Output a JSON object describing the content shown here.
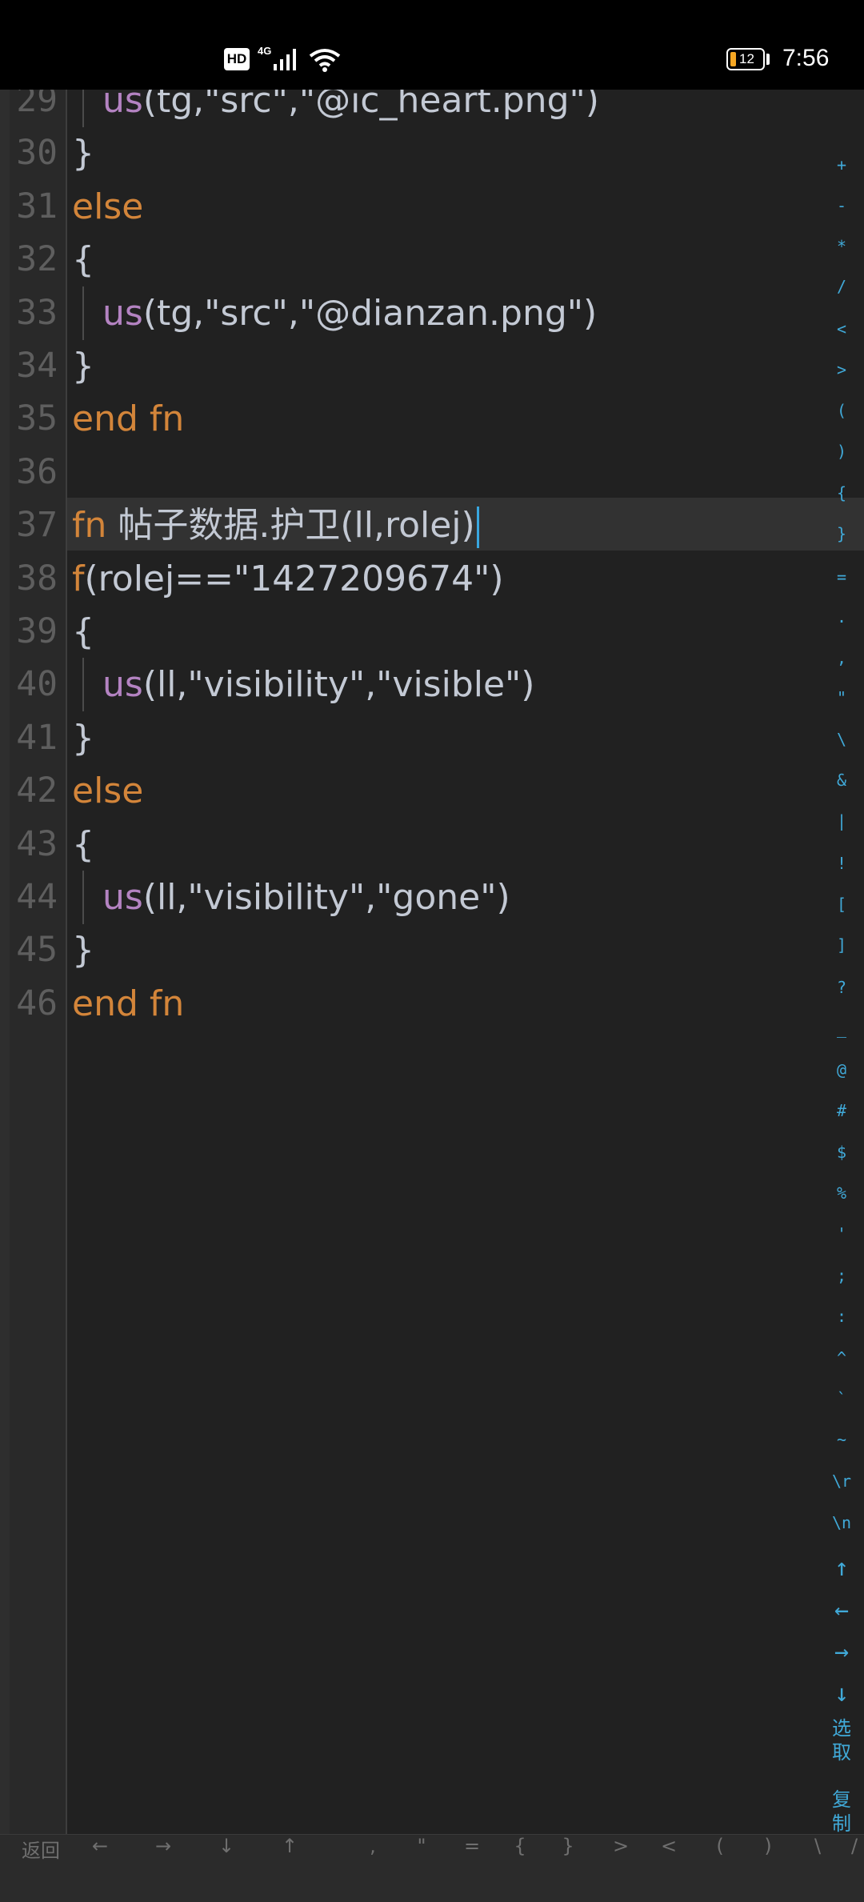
{
  "status_bar": {
    "hd": "HD",
    "network": "4G",
    "battery": "12",
    "time": "7:56"
  },
  "editor": {
    "lines": [
      {
        "n": "29",
        "indent": true,
        "tokens": [
          {
            "t": "us",
            "c": "fnc"
          },
          {
            "t": "(tg,\"src\",\"@ic_heart.png\")",
            "c": ""
          }
        ]
      },
      {
        "n": "30",
        "indent": false,
        "tokens": [
          {
            "t": "}",
            "c": ""
          }
        ]
      },
      {
        "n": "31",
        "indent": false,
        "tokens": [
          {
            "t": "else",
            "c": "kw"
          }
        ]
      },
      {
        "n": "32",
        "indent": false,
        "tokens": [
          {
            "t": "{",
            "c": ""
          }
        ]
      },
      {
        "n": "33",
        "indent": true,
        "tokens": [
          {
            "t": "us",
            "c": "fnc"
          },
          {
            "t": "(tg,\"src\",\"@dianzan.png\")",
            "c": ""
          }
        ]
      },
      {
        "n": "34",
        "indent": false,
        "tokens": [
          {
            "t": "}",
            "c": ""
          }
        ]
      },
      {
        "n": "35",
        "indent": false,
        "tokens": [
          {
            "t": "end fn",
            "c": "kw"
          }
        ]
      },
      {
        "n": "36",
        "indent": false,
        "tokens": []
      },
      {
        "n": "37",
        "indent": false,
        "current": true,
        "tokens": [
          {
            "t": "fn",
            "c": "kw"
          },
          {
            "t": " 帖子数据.护卫(ll,rolej)",
            "c": ""
          }
        ]
      },
      {
        "n": "38",
        "indent": false,
        "tokens": [
          {
            "t": "f",
            "c": "kw"
          },
          {
            "t": "(rolej==\"1427209674\")",
            "c": ""
          }
        ]
      },
      {
        "n": "39",
        "indent": false,
        "tokens": [
          {
            "t": "{",
            "c": ""
          }
        ]
      },
      {
        "n": "40",
        "indent": true,
        "tokens": [
          {
            "t": "us",
            "c": "fnc"
          },
          {
            "t": "(ll,\"visibility\",\"visible\")",
            "c": ""
          }
        ]
      },
      {
        "n": "41",
        "indent": false,
        "tokens": [
          {
            "t": "}",
            "c": ""
          }
        ]
      },
      {
        "n": "42",
        "indent": false,
        "tokens": [
          {
            "t": "else",
            "c": "kw"
          }
        ]
      },
      {
        "n": "43",
        "indent": false,
        "tokens": [
          {
            "t": "{",
            "c": ""
          }
        ]
      },
      {
        "n": "44",
        "indent": true,
        "tokens": [
          {
            "t": "us",
            "c": "fnc"
          },
          {
            "t": "(ll,\"visibility\",\"gone\")",
            "c": ""
          }
        ]
      },
      {
        "n": "45",
        "indent": false,
        "tokens": [
          {
            "t": "}",
            "c": ""
          }
        ]
      },
      {
        "n": "46",
        "indent": false,
        "tokens": [
          {
            "t": "end fn",
            "c": "kw"
          }
        ]
      }
    ]
  },
  "symbol_strip": [
    "+",
    "-",
    "*",
    "/",
    "<",
    ">",
    "(",
    ")",
    "{",
    "}",
    "=",
    ".",
    ",",
    "\"",
    "\\",
    "&",
    "|",
    "!",
    "[",
    "]",
    "?",
    "_",
    "@",
    "#",
    "$",
    "%",
    "'",
    ";",
    ":",
    "^",
    "`",
    "~",
    "\\r",
    "\\n",
    "↑",
    "←",
    "→",
    "↓",
    "选取",
    "复制"
  ],
  "bottom_bar": [
    "返回",
    "←",
    "→",
    "↓",
    "↑",
    ",",
    "\"",
    "=",
    "{",
    "}",
    ">",
    "<",
    "(",
    ")",
    "\\",
    "/"
  ],
  "colors": {
    "background": "#212121",
    "keyword": "#d3853a",
    "function": "#b483c2",
    "text": "#c3c9d4",
    "line_number": "#5e5e5e",
    "symbol_accent": "#40a9d8",
    "cursor": "#39a7e0"
  }
}
